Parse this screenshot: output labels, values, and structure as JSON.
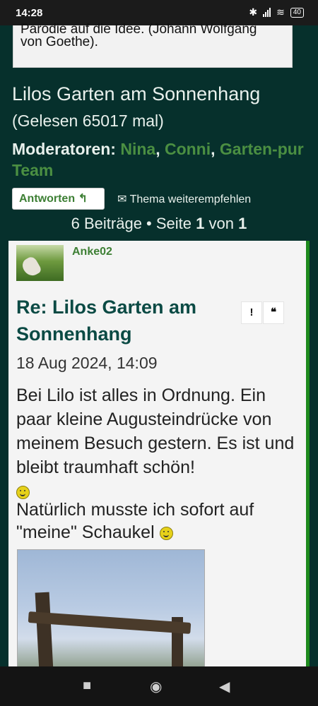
{
  "status_bar": {
    "time": "14:28",
    "battery": "40"
  },
  "quote": {
    "line1": "Parodie auf die Idee. (Johann Wolfgang",
    "line2": "von Goethe)."
  },
  "topic": {
    "title": "Lilos Garten am Sonnenhang",
    "reads": "(Gelesen 65017 mal)",
    "moderators_label": "Moderatoren:",
    "moderators": [
      "Nina",
      "Conni",
      "Garten-pur Team"
    ]
  },
  "actions": {
    "reply_label": "Antworten",
    "recommend_label": "Thema weiterempfehlen"
  },
  "pagination": {
    "count": "6 Beiträge",
    "sep": " • ",
    "page_prefix": "Seite ",
    "current": "1",
    "of": " von ",
    "total": "1"
  },
  "post": {
    "author": "Anke02",
    "title": "Re: Lilos Garten am Sonnenhang",
    "report_label": "!",
    "quote_label": "❝",
    "date": "18 Aug 2024, 14:09",
    "body1": "Bei Lilo ist alles in Ordnung. Ein paar kleine Augusteindrücke von meinem Besuch gestern. Es ist und bleibt traumhaft schön!",
    "body2": "Natürlich musste ich sofort auf \"meine\" Schaukel"
  },
  "nav": {
    "recents": "■",
    "home": "◉",
    "back": "◀"
  },
  "colors": {
    "background": "#06302c",
    "accent": "#3d7f34",
    "post_border": "#1d8a1d",
    "title": "#0b4a44"
  }
}
